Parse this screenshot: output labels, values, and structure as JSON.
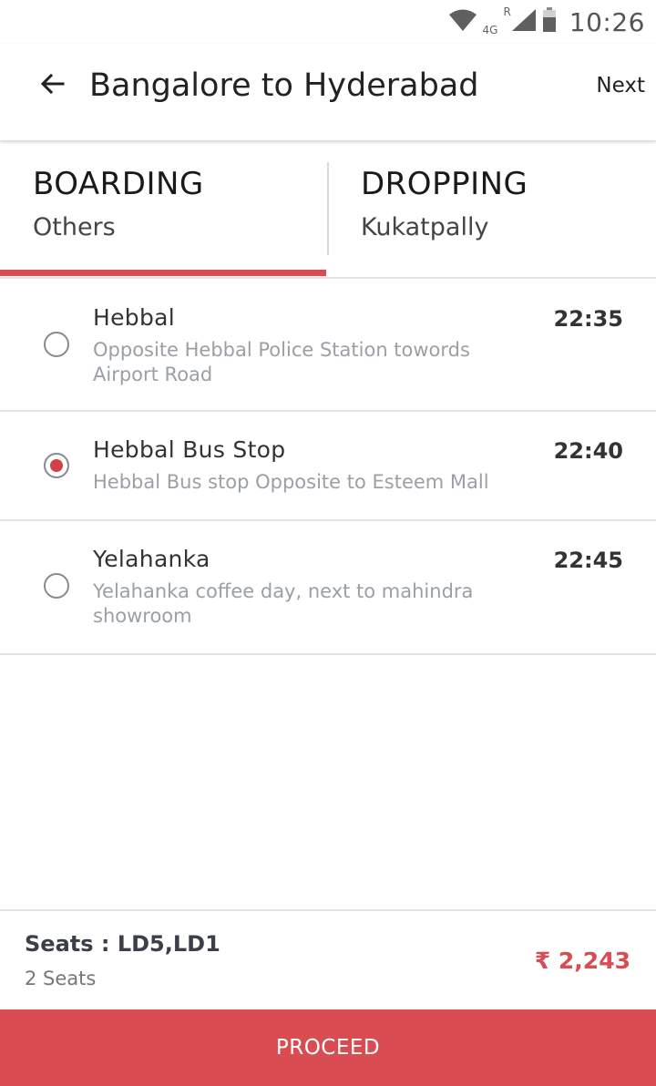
{
  "status_bar": {
    "network_label": "4G",
    "roaming_label": "R",
    "time": "10:26",
    "icons": [
      "wifi-icon",
      "signal-icon",
      "battery-icon"
    ]
  },
  "app_bar": {
    "title": "Bangalore to Hyderabad",
    "next_label": "Next",
    "back_icon": "arrow-left-icon"
  },
  "tabs": [
    {
      "title": "BOARDING",
      "subtitle": "Others",
      "active": true
    },
    {
      "title": "DROPPING",
      "subtitle": "Kukatpally",
      "active": false
    }
  ],
  "stops": [
    {
      "name": "Hebbal",
      "description": "Opposite Hebbal Police Station towords Airport Road",
      "time": "22:35",
      "selected": false
    },
    {
      "name": "Hebbal Bus Stop",
      "description": "Hebbal Bus stop Opposite to Esteem Mall",
      "time": "22:40",
      "selected": true
    },
    {
      "name": "Yelahanka",
      "description": "Yelahanka coffee day, next to mahindra showroom",
      "time": "22:45",
      "selected": false
    }
  ],
  "summary": {
    "seats_label": "Seats : LD5,LD1",
    "seats_count": "2 Seats",
    "fare": "₹ 2,243"
  },
  "proceed_label": "PROCEED",
  "colors": {
    "accent": "#d84c52",
    "radio_fill": "#d2404a",
    "subtext": "#9aa0a6",
    "divider": "#e3e3e3"
  }
}
